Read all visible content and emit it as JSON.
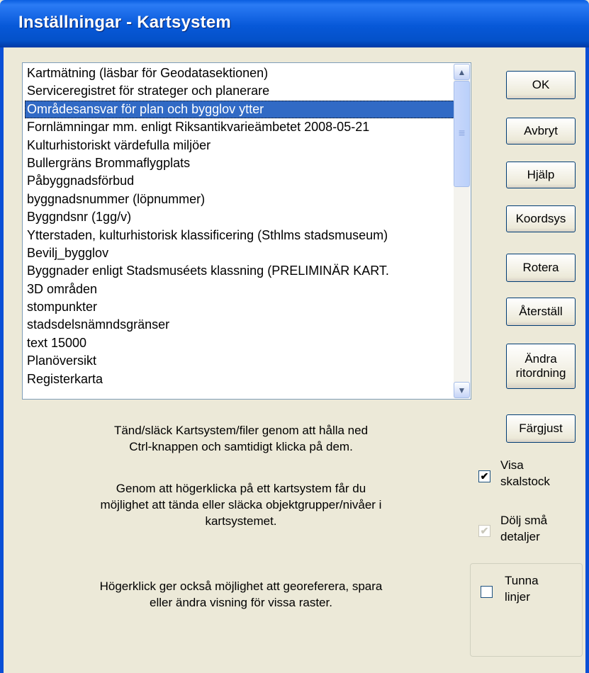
{
  "window": {
    "title": "Inställningar - Kartsystem"
  },
  "list": {
    "items": [
      "Kartmätning (läsbar för Geodatasektionen)",
      "Serviceregistret för strateger och planerare",
      "Områdesansvar för plan och bygglov ytter",
      "Fornlämningar mm. enligt Riksantikvarieämbetet 2008-05-21",
      "Kulturhistoriskt värdefulla miljöer",
      "Bullergräns Brommaflygplats",
      "Påbyggnadsförbud",
      "byggnadsnummer (löpnummer)",
      "Byggndsnr (1gg/v)",
      "Ytterstaden, kulturhistorisk klassificering (Sthlms stadsmuseum)",
      "Bevilj_bygglov",
      "Byggnader enligt Stadsmuséets klassning (PRELIMINÄR KART.",
      "3D områden",
      "stompunkter",
      "stadsdelsnämndsgränser",
      "text 15000",
      "Planöversikt",
      "Registerkarta"
    ],
    "selected_index": 2
  },
  "buttons": {
    "ok": "OK",
    "cancel": "Avbryt",
    "help": "Hjälp",
    "coordsys": "Koordsys",
    "rotate": "Rotera",
    "reset": "Återställ",
    "change_line1": "Ändra",
    "change_line2": "ritordning",
    "color": "Färgjust"
  },
  "info": {
    "p1_line1": "Tänd/släck Kartsystem/filer genom att hålla ned",
    "p1_line2": "Ctrl-knappen och samtidigt klicka på dem.",
    "p2_line1": "Genom att högerklicka på ett kartsystem får du",
    "p2_line2": "möjlighet att tända eller släcka objektgrupper/nivåer i",
    "p2_line3": "kartsystemet.",
    "p3_line1": "Högerklick ger också möjlighet att georeferera, spara",
    "p3_line2": "eller ändra visning för vissa raster."
  },
  "checkboxes": {
    "scale": {
      "line1": "Visa",
      "line2": "skalstock",
      "checked": true
    },
    "hide_details": {
      "line1": "Dölj små",
      "line2": "detaljer",
      "checked": true,
      "disabled": true
    },
    "thin_lines": {
      "line1": "Tunna",
      "line2": "linjer",
      "checked": false
    }
  },
  "icons": {
    "check": "✔",
    "up": "▲",
    "down": "▼",
    "grip": "≡"
  }
}
